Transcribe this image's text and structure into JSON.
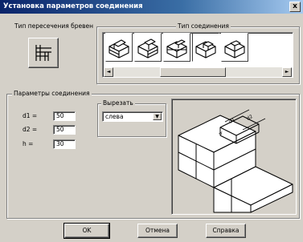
{
  "window": {
    "title": "Установка параметров соединения",
    "close_glyph": "x"
  },
  "intersection": {
    "caption": "Тип пересечения бревен"
  },
  "connection": {
    "caption": "Тип соединения",
    "tile_count_visible": 5,
    "selected_tile": 4,
    "scroll_left_glyph": "◄",
    "scroll_right_glyph": "►"
  },
  "params": {
    "caption": "Параметры соединения",
    "d1_label": "d1 =",
    "d1_value": "50",
    "d2_label": "d2 =",
    "d2_value": "50",
    "h_label": "h =",
    "h_value": "30"
  },
  "cut": {
    "caption": "Вырезать",
    "selected": "слева",
    "arrow_glyph": "▼"
  },
  "preview": {
    "labels": [
      "d1",
      "d2",
      "h"
    ]
  },
  "buttons": {
    "ok": "OK",
    "cancel": "Отмена",
    "help": "Справка"
  }
}
